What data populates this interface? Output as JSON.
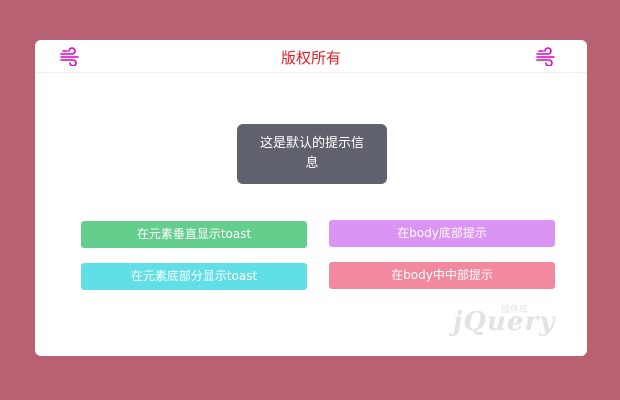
{
  "header": {
    "title": "版权所有",
    "title_color": "#e0202a",
    "left_icon": "wind-icon",
    "right_icon": "wind-icon",
    "icon_color": "#e000c8"
  },
  "toast": {
    "message": "这是默认的提示信息"
  },
  "buttons": [
    {
      "label": "在元素垂直显示toast",
      "color": "#64cf8c"
    },
    {
      "label": "在body底部提示",
      "color": "#dc94f4"
    },
    {
      "label": "在元素底部分显示toast",
      "color": "#60dfe6"
    },
    {
      "label": "在body中中部提示",
      "color": "#f2899f"
    }
  ],
  "watermark": {
    "text": "jQuery",
    "sub": "插件库"
  },
  "colors": {
    "page_background": "#b86173",
    "card_background": "#ffffff",
    "toast_background": "#5f626c"
  }
}
